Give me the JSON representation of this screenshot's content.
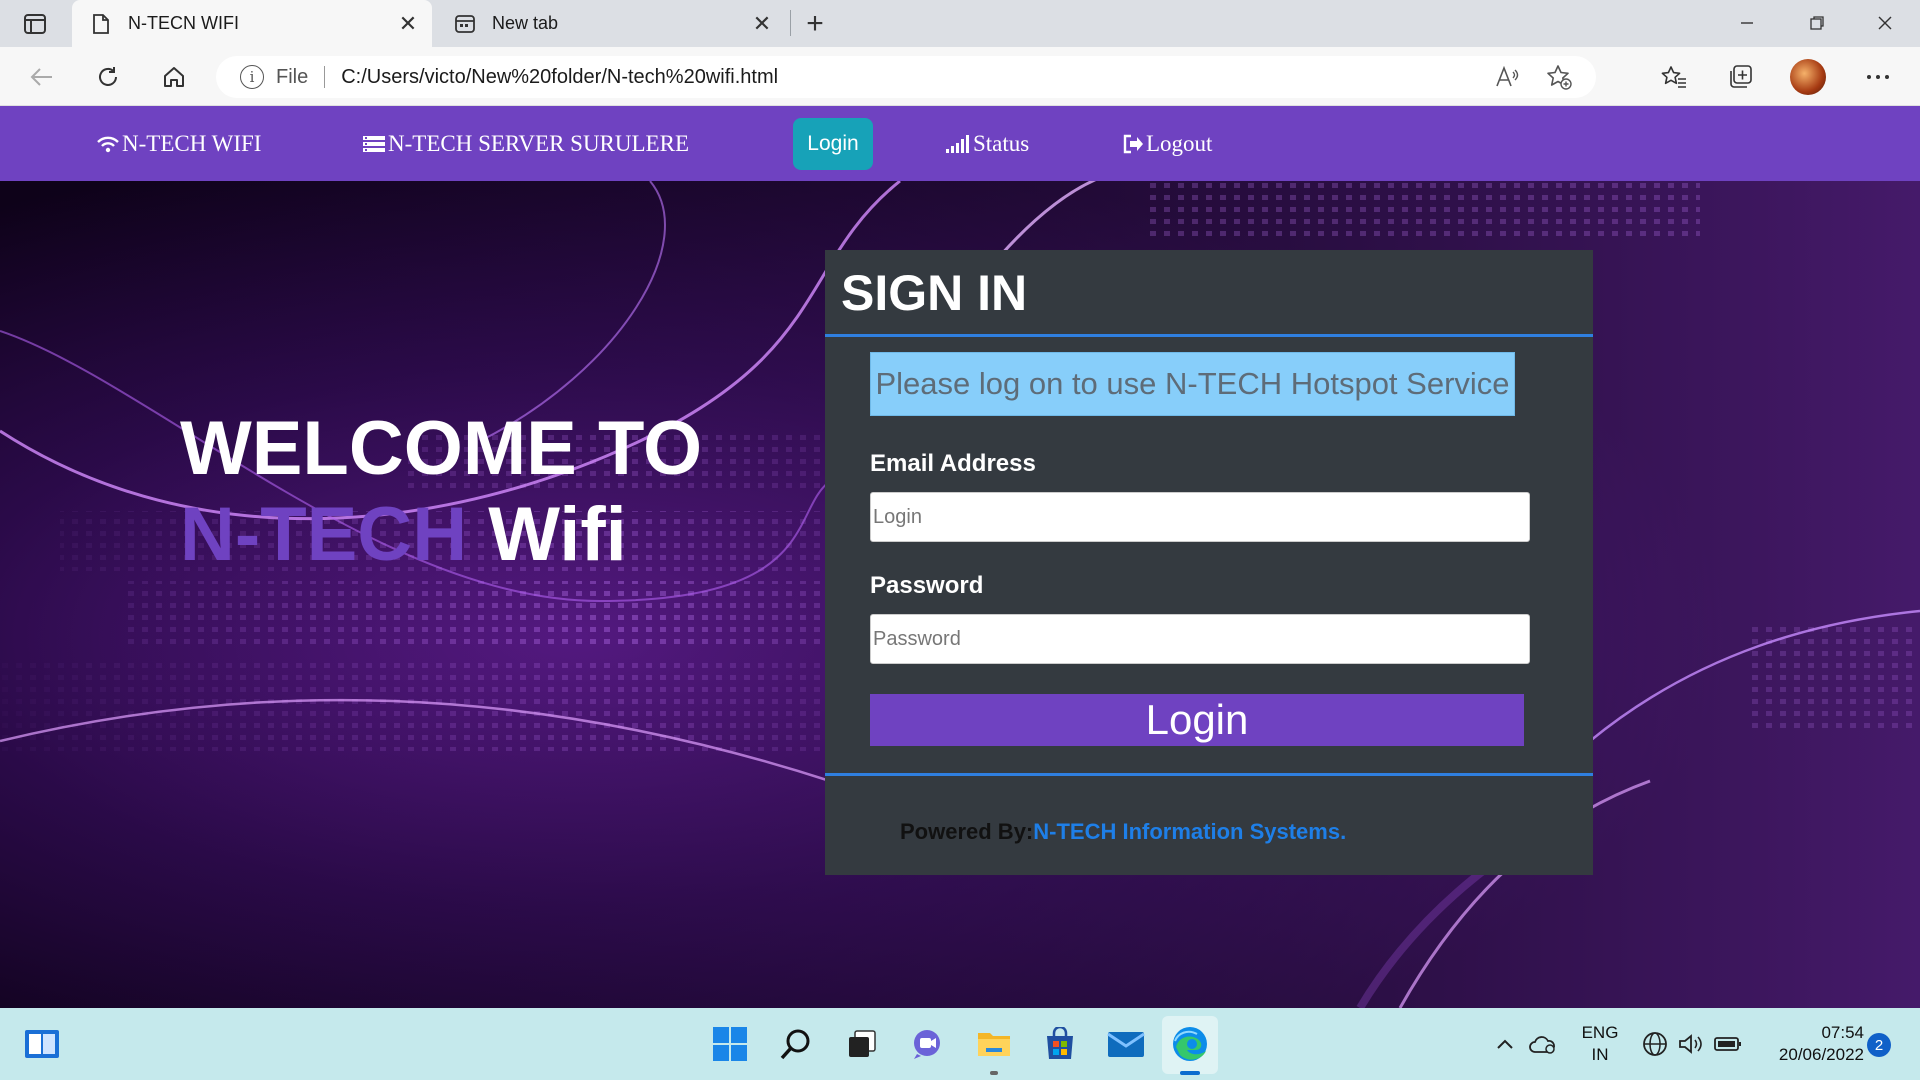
{
  "browser": {
    "tabs": [
      {
        "title": "N-TECN WIFI",
        "active": true
      },
      {
        "title": "New tab",
        "active": false
      }
    ],
    "address": {
      "scheme_label": "File",
      "url": "C:/Users/victo/New%20folder/N-tech%20wifi.html"
    }
  },
  "navbar": {
    "brand": "N-TECH WIFI",
    "server": "N-TECH SERVER SURULERE",
    "login": "Login",
    "status": "Status",
    "logout": "Logout"
  },
  "hero": {
    "line1": "WELCOME TO",
    "brand": "N-TECH",
    "line2_rest": " Wifi"
  },
  "signin": {
    "title": "SIGN IN",
    "notice": "Please log on to use N-TECH Hotspot Service",
    "email_label": "Email Address",
    "email_placeholder": "Login",
    "password_label": "Password",
    "password_placeholder": "Password",
    "submit": "Login",
    "powered_prefix": "Powered By:",
    "powered_company": "N-TECH Information Systems."
  },
  "taskbar": {
    "language_top": "ENG",
    "language_bottom": "IN",
    "time": "07:54",
    "date": "20/06/2022",
    "notification_count": "2"
  },
  "colors": {
    "brand_purple": "#6f42c1",
    "login_teal": "#17a2b8",
    "card_dark": "#343a40",
    "notice_blue": "#87cefa",
    "link_blue": "#1e7fe8"
  }
}
